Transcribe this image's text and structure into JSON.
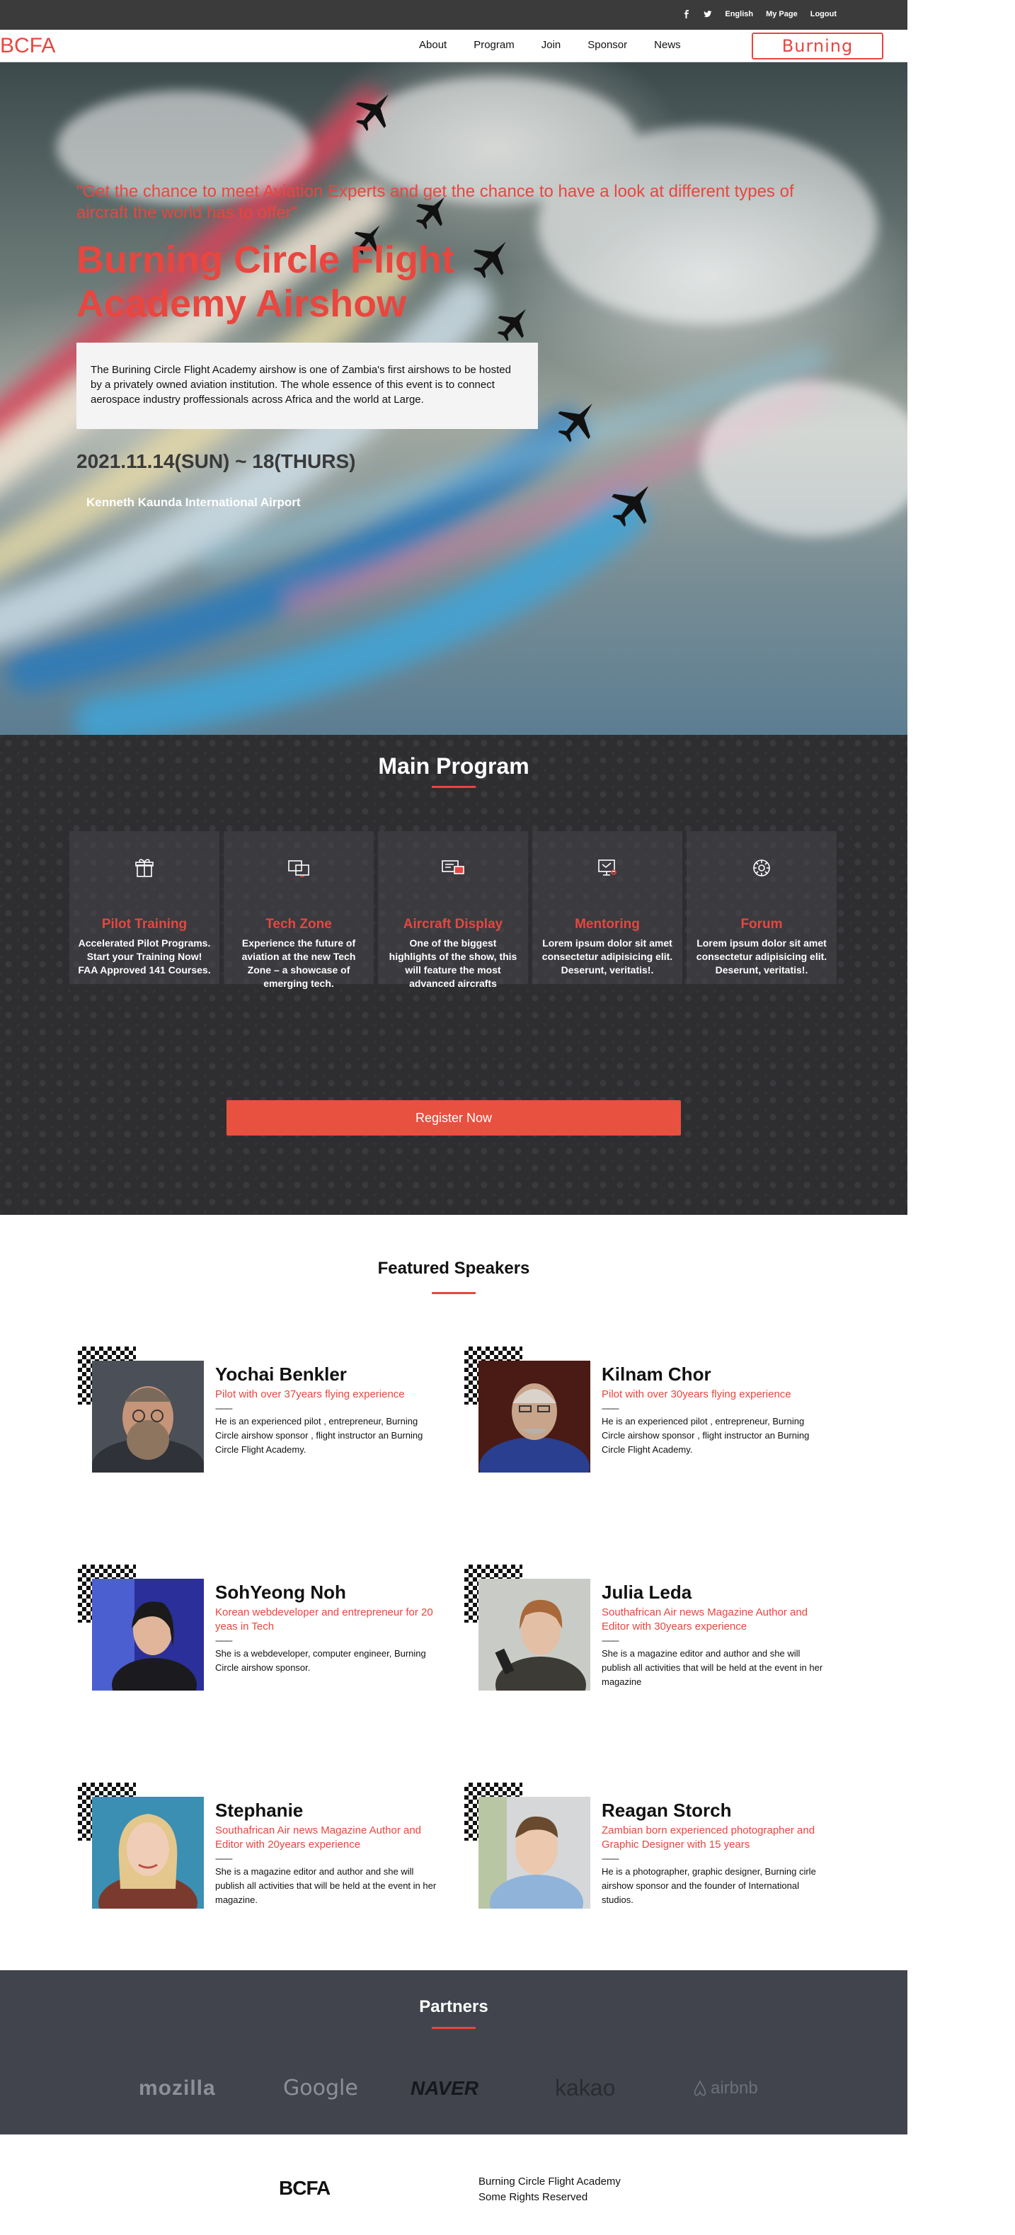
{
  "topbar": {
    "facebook_icon": "facebook-icon",
    "twitter_icon": "twitter-icon",
    "language": "English",
    "mypage": "My Page",
    "logout": "Logout"
  },
  "nav": {
    "logo": "BCFA",
    "items": [
      "About",
      "Program",
      "Join",
      "Sponsor",
      "News"
    ],
    "brand": "Burning Circle"
  },
  "hero": {
    "quote": "\"Get the chance to meet Aviation Experts and get the chance to have a look at different types of aircraft the world has to offer\"",
    "title": "Burning Circle Flight Academy Airshow",
    "description": "The Burining Circle Flight Academy airshow is one of Zambia's first airshows to be hosted by a privately owned aviation institution. The whole essence of this event is to connect aerospace industry proffessionals across Africa and the world at Large.",
    "dates": "2021.11.14(SUN) ~ 18(THURS)",
    "venue": "Kenneth Kaunda International Airport"
  },
  "program": {
    "title": "Main Program",
    "cards": [
      {
        "title": "Pilot Training",
        "text": "Accelerated Pilot Programs. Start your Training Now! FAA Approved 141 Courses.",
        "icon": "gift-icon"
      },
      {
        "title": "Tech Zone",
        "text": "Experience the future of aviation at the new Tech Zone – a showcase of emerging tech.",
        "icon": "screens-icon"
      },
      {
        "title": "Aircraft Display",
        "text": "One of the biggest highlights of the show, this will feature the most advanced aircrafts",
        "icon": "display-icon"
      },
      {
        "title": "Mentoring",
        "text": "Lorem ipsum dolor sit amet consectetur adipisicing elit. Deserunt, veritatis!.",
        "icon": "monitor-icon"
      },
      {
        "title": "Forum",
        "text": "Lorem ipsum dolor sit amet consectetur adipisicing elit. Deserunt, veritatis!.",
        "icon": "gear-icon"
      }
    ],
    "register": "Register Now"
  },
  "speakers": {
    "title": "Featured Speakers",
    "items": [
      {
        "name": "Yochai Benkler",
        "role": "Pilot with over 37years flying experience",
        "dash": "---------",
        "bio": "He is an experienced pilot , entrepreneur, Burning Circle airshow sponsor , flight instructor an Burning Circle Flight Academy."
      },
      {
        "name": "Kilnam Chor",
        "role": "Pilot with over 30years flying experience",
        "dash": "---------",
        "bio": "He is an experienced pilot , entrepreneur, Burning Circle airshow sponsor , flight instructor an Burning Circle Flight Academy."
      },
      {
        "name": "SohYeong Noh",
        "role": "Korean webdeveloper and entrepreneur for 20 yeas in Tech",
        "dash": "---------",
        "bio": "She is a webdeveloper, computer engineer, Burning Circle airshow sponsor."
      },
      {
        "name": "Julia Leda",
        "role": "Southafrican Air news Magazine Author and Editor with 30years experience",
        "dash": "---------",
        "bio": "She is a magazine editor and author and she will publish all activities that will be held at the event in her magazine"
      },
      {
        "name": "Stephanie",
        "role": "Southafrican Air news Magazine Author and Editor with 20years experience",
        "dash": "---------",
        "bio": "She is a magazine editor and author and she will publish all activities that will be held at the event in her magazine."
      },
      {
        "name": "Reagan Storch",
        "role": "Zambian born experienced photographer and Graphic Designer with 15 years",
        "dash": "---------",
        "bio": "He is a photographer, graphic designer, Burning cirle airshow sponsor and the founder of International studios."
      }
    ]
  },
  "partners": {
    "title": "Partners",
    "logos": [
      "mozilla",
      "Google",
      "NAVER",
      "kakao",
      "airbnb"
    ]
  },
  "footer": {
    "logo": "BCFA",
    "line1": "Burning Circle Flight Academy",
    "line2": "Some Rights Reserved"
  },
  "colors": {
    "accent": "#e8463f",
    "dark": "#2e2e31",
    "partners_bg": "#41444c"
  }
}
